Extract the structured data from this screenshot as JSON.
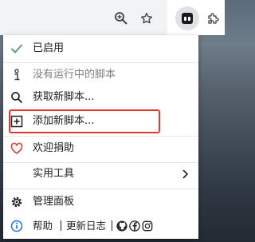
{
  "menu": {
    "enabled_label": "已启用",
    "no_scripts_label": "没有运行中的脚本",
    "get_scripts_label": "获取新脚本...",
    "add_script_label": "添加新脚本...",
    "donate_label": "欢迎捐助",
    "utilities_label": "实用工具",
    "dashboard_label": "管理面板",
    "help_label": "帮助",
    "changelog_label": "更新日志",
    "separator_glyph": "|"
  },
  "icons": {
    "enabled": "check-icon",
    "no_scripts": "info-person-icon",
    "get_scripts": "search-icon",
    "add_script": "plus-square-icon",
    "donate": "heart-icon",
    "utilities": "chevron-right-icon",
    "dashboard": "gear-icon",
    "help": "info-icon",
    "social": [
      "github-icon",
      "facebook-icon",
      "instagram-icon"
    ]
  },
  "colors": {
    "check_green": "#5aa469",
    "heart_red": "#e0443a",
    "highlight_red": "#e03a2e",
    "info_blue": "#1a73e8"
  }
}
